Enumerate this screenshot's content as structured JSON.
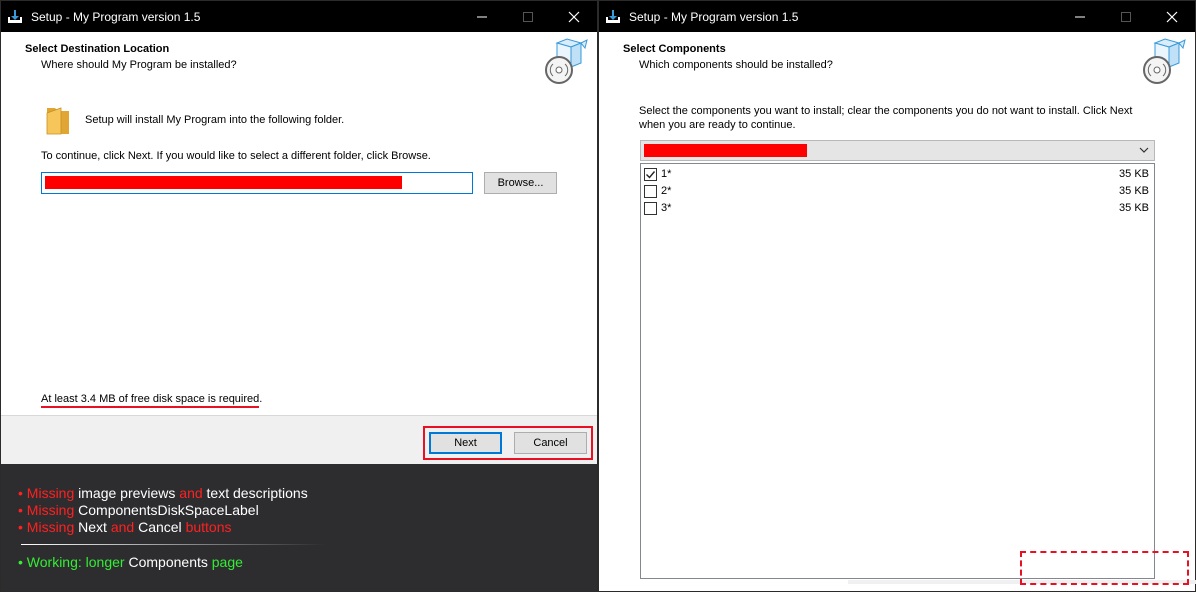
{
  "left_window": {
    "title": "Setup - My Program version 1.5",
    "header_title": "Select Destination Location",
    "header_subtitle": "Where should My Program be installed?",
    "folder_text": "Setup will install My Program into the following folder.",
    "continue_text": "To continue, click Next. If you would like to select a different folder, click Browse.",
    "browse_label": "Browse...",
    "disk_space_text": "At least 3.4 MB of free disk space is required.",
    "next_label": "Next",
    "cancel_label": "Cancel"
  },
  "notes": {
    "line1": {
      "p1": "• Missing",
      "p2": "image previews",
      "p3": "and",
      "p4": "text descriptions"
    },
    "line2": {
      "p1": "• Missing",
      "p2": "ComponentsDiskSpaceLabel"
    },
    "line3": {
      "p1": "• Missing",
      "p2": "Next",
      "p3": "and",
      "p4": "Cancel",
      "p5": "buttons"
    },
    "line4": {
      "p1": "• Working: longer",
      "p2": "Components",
      "p3": "page"
    }
  },
  "right_window": {
    "title": "Setup - My Program version 1.5",
    "header_title": "Select Components",
    "header_subtitle": "Which components should be installed?",
    "instruction_line1": "Select the components you want to install; clear the components you do not want to install. Click Next",
    "instruction_line2": "when you are ready to continue.",
    "components": [
      {
        "name": "1*",
        "size": "35 KB",
        "checked": true
      },
      {
        "name": "2*",
        "size": "35 KB",
        "checked": false
      },
      {
        "name": "3*",
        "size": "35 KB",
        "checked": false
      }
    ]
  },
  "colors": {
    "titlebar": "#000000",
    "accent": "#0078d7",
    "highlight_red": "#e81123",
    "redaction": "#ff0000",
    "notes_background": "#2d2d30",
    "notes_red": "#ff2020",
    "notes_green": "#33ee33"
  },
  "icons": {
    "app": "setup-download-icon",
    "wizard": "box-with-disc-icon",
    "folder": "folder-icon",
    "dropdown": "chevron-down-icon",
    "check": "check-icon"
  }
}
